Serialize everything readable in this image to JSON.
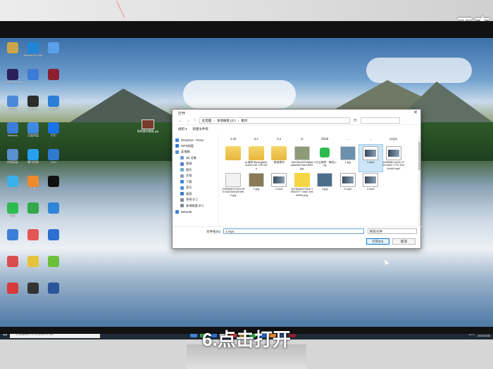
{
  "watermark": "天奇",
  "caption": "6.点击打开",
  "desktop": {
    "icons": [
      {
        "label": "...",
        "color": "#c9a64a"
      },
      {
        "label": "Microsoft Edge",
        "color": "#1f86d6"
      },
      {
        "label": "...",
        "color": "#5aa0e8"
      },
      {
        "label": "Adobe Premiere",
        "color": "#2a1f5a"
      },
      {
        "label": "...",
        "color": "#3e7ad8"
      },
      {
        "label": "...",
        "color": "#8a2030"
      },
      {
        "label": "此电脑",
        "color": "#4b89d8"
      },
      {
        "label": "腾讯QQ",
        "color": "#2d2d2d"
      },
      {
        "label": "360安全",
        "color": "#2b7fd8"
      },
      {
        "label": "Network",
        "color": "#3b7dd8"
      },
      {
        "label": "百度网盘",
        "color": "#3e8ae0"
      },
      {
        "label": "钉钉",
        "color": "#1a73e8"
      },
      {
        "label": "控制面板",
        "color": "#5a8fd0"
      },
      {
        "label": "腾讯视频",
        "color": "#27a0f0"
      },
      {
        "label": "IDM",
        "color": "#2d7ad0"
      },
      {
        "label": "...",
        "color": "#3ab0e8"
      },
      {
        "label": "剪映",
        "color": "#ef8a2c"
      },
      {
        "label": "抖音",
        "color": "#111111"
      },
      {
        "label": "微信",
        "color": "#2dbb4e"
      },
      {
        "label": "...",
        "color": "#33a84a"
      },
      {
        "label": "...",
        "color": "#2f85d8"
      },
      {
        "label": "...",
        "color": "#3d7fd8"
      },
      {
        "label": "...",
        "color": "#e45555"
      },
      {
        "label": "...",
        "color": "#2d6fd0"
      },
      {
        "label": "...",
        "color": "#d94d4d"
      },
      {
        "label": "...",
        "color": "#e5c23a"
      },
      {
        "label": "...",
        "color": "#6bbf3a"
      },
      {
        "label": "...",
        "color": "#d83a3a"
      },
      {
        "label": "...",
        "color": "#333333"
      },
      {
        "label": "...",
        "color": "#2b579a"
      }
    ],
    "file_label": "哈哈素材模板.jpg"
  },
  "dialog": {
    "title": "打开",
    "close_label": "✕",
    "back": "←",
    "forward": "→",
    "up": "↑",
    "breadcrumb": [
      "此电脑",
      "本地磁盘 (D:)",
      "素材"
    ],
    "refresh": "⟳",
    "search_placeholder": "",
    "organize_label": "组织 ▾",
    "new_folder_label": "新建文件夹",
    "nav_items": [
      {
        "label": "OneDrive - Perso",
        "color": "#3b86d8",
        "sub": false
      },
      {
        "label": "WPS网盘",
        "color": "#2d7ad0",
        "sub": false
      },
      {
        "label": "此电脑",
        "color": "#5a8fd0",
        "sub": false
      },
      {
        "label": "3D 对象",
        "color": "#6b9bd8",
        "sub": true
      },
      {
        "label": "视频",
        "color": "#5a7bd0",
        "sub": true
      },
      {
        "label": "图片",
        "color": "#6baad8",
        "sub": true
      },
      {
        "label": "文档",
        "color": "#8aa0c0",
        "sub": true
      },
      {
        "label": "下载",
        "color": "#3a8ad8",
        "sub": true
      },
      {
        "label": "音乐",
        "color": "#4a90d8",
        "sub": true
      },
      {
        "label": "桌面",
        "color": "#3d78c8",
        "sub": true
      },
      {
        "label": "系统 (C:)",
        "color": "#7f8a96",
        "sub": true
      },
      {
        "label": "本地磁盘 (D:)",
        "color": "#7f8a96",
        "sub": true
      },
      {
        "label": "Network",
        "color": "#3b7dd8",
        "sub": false
      }
    ],
    "top_row": [
      "3.30",
      "8.2",
      "9.2",
      "ai",
      "bilibili",
      "...",
      "...",
      "pelyin"
    ],
    "rows": [
      [
        {
          "name": "",
          "kind": "folder",
          "color": "#f0c94c"
        },
        {
          "name": "js-素材 Beautyfy8cvxAXU A0 +PR-Win",
          "kind": "folder",
          "color": "#f0c94c"
        },
        {
          "name": "修图素材",
          "kind": "folder",
          "color": "#f0c94c"
        },
        {
          "name": "0ab23ee4f7088adaabe5be7afc1f5f2f.jpg",
          "kind": "img",
          "color": "#8c9a76"
        },
        {
          "name": "1 红豆抹茶 - 微信.png",
          "kind": "wechat",
          "color": "#2dbb4e"
        },
        {
          "name": "1.jpg",
          "kind": "img",
          "color": "#6d8fae"
        },
        {
          "name": "1.mp4",
          "kind": "vid",
          "color": "#4b5d6e",
          "selected": true
        },
        {
          "name": "1b6f8981-9e5c-4759-bd32-7791 5c34c6a3.mp4",
          "kind": "vid",
          "color": "#4b5d6e"
        }
      ],
      [
        {
          "name": "02f96d0f737824 8ffc7a20340428 8fe2.jpg",
          "kind": "doc",
          "color": "#e5e5e5"
        },
        {
          "name": "2.jpg",
          "kind": "img",
          "color": "#8b7a56"
        },
        {
          "name": "2.mp4",
          "kind": "vid",
          "color": "#5b4a3e"
        },
        {
          "name": "2b78a4b0075b5 15062977 0dd2 3d6d5f3d.png",
          "kind": "sticky",
          "color": "#f5d544"
        },
        {
          "name": "3.jpg",
          "kind": "img",
          "color": "#4b6e8a"
        },
        {
          "name": "3.mp4",
          "kind": "vid",
          "color": "#3a4a5a"
        },
        {
          "name": "4.mp4",
          "kind": "vid",
          "color": "#3a5a6a"
        }
      ]
    ],
    "filename_label": "文件名(N):",
    "filename_value": "1.mp4",
    "filter_value": "所有文件",
    "open_label": "打开(O)",
    "cancel_label": "取消"
  },
  "taskbar": {
    "start": "⊞",
    "search_placeholder": "在这里输入你要搜索的内容",
    "app_colors": [
      "#3b86d8",
      "#31a84c",
      "#2d6fd0",
      "#dcdcdc",
      "#d83a3a",
      "#e5c23a",
      "#2dbb4e",
      "#1a73e8",
      "#ef8a2c",
      "#2b579a",
      "#8a2030"
    ],
    "weather": "11°C",
    "time": "16:28",
    "date": "2022/3/30"
  }
}
